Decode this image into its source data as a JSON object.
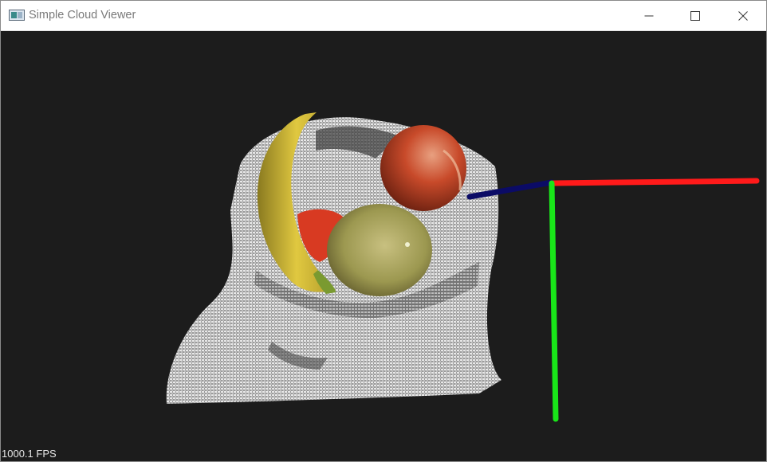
{
  "window": {
    "title": "Simple Cloud Viewer",
    "controls": [
      "minimize",
      "maximize",
      "close"
    ]
  },
  "viewport": {
    "background": "#1c1c1c",
    "fps_label": "1000.1 FPS",
    "axes": {
      "x_color": "#ff1a1a",
      "y_color": "#19e619",
      "z_color": "#0b0b66"
    }
  },
  "icons": [
    "app-icon",
    "minimize-icon",
    "maximize-icon",
    "close-icon"
  ]
}
